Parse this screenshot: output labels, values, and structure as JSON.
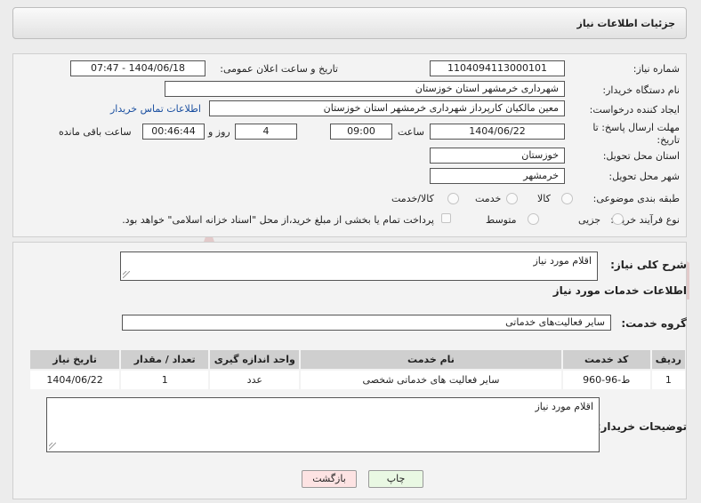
{
  "header": {
    "title": "جزئیات اطلاعات نیاز"
  },
  "form": {
    "need_number_label": "شماره نیاز:",
    "need_number": "1104094113000101",
    "announce_label": "تاریخ و ساعت اعلان عمومی:",
    "announce_value": "1404/06/18 - 07:47",
    "buyer_org_label": "نام دستگاه خریدار:",
    "buyer_org": "شهرداری خرمشهر استان خوزستان",
    "requester_label": "ایجاد کننده درخواست:",
    "requester": "معین مالکیان کارپرداز شهرداری خرمشهر استان خوزستان",
    "buyer_contact_link": "اطلاعات تماس خریدار",
    "deadline_label": "مهلت ارسال پاسخ: تا تاریخ:",
    "deadline_date": "1404/06/22",
    "time_label": "ساعت",
    "deadline_time": "09:00",
    "days_value": "4",
    "days_label": "روز و",
    "remaining_value": "00:46:44",
    "remaining_label": "ساعت باقی مانده",
    "province_label": "استان محل تحویل:",
    "province": "خوزستان",
    "city_label": "شهر محل تحویل:",
    "city": "خرمشهر",
    "category_label": "طبقه بندی موضوعی:",
    "category_options": [
      "کالا",
      "خدمت",
      "کالا/خدمت"
    ],
    "process_label": "نوع فرآیند خرید :",
    "process_options": [
      "جزیی",
      "متوسط"
    ],
    "payment_note": "پرداخت تمام یا بخشی از مبلغ خرید،از محل \"اسناد خزانه اسلامی\" خواهد بود."
  },
  "details": {
    "summary_label": "شرح کلی نیاز:",
    "summary_text": "اقلام مورد نیاز",
    "services_heading": "اطلاعات خدمات مورد نیاز",
    "service_group_label": "گروه خدمت:",
    "service_group": "سایر فعالیت‌های خدماتی",
    "table": {
      "headers": [
        "ردیف",
        "کد خدمت",
        "نام خدمت",
        "واحد اندازه گیری",
        "تعداد / مقدار",
        "تاریخ نیاز"
      ],
      "rows": [
        [
          "1",
          "ط-96-960",
          "سایر فعالیت های خدماتی شخصی",
          "عدد",
          "1",
          "1404/06/22"
        ]
      ]
    },
    "buyer_notes_label": "توضیحات خریدار:",
    "buyer_notes": "اقلام مورد نیاز"
  },
  "buttons": {
    "print": "چاپ",
    "back": "بازگشت"
  },
  "watermark": {
    "text": "AriaTender.neT"
  },
  "colors": {
    "link": "#1a4fa0",
    "back_button_bg": "#fde3e3",
    "print_button_bg": "#e9f8e3",
    "watermark": "#b22222"
  }
}
